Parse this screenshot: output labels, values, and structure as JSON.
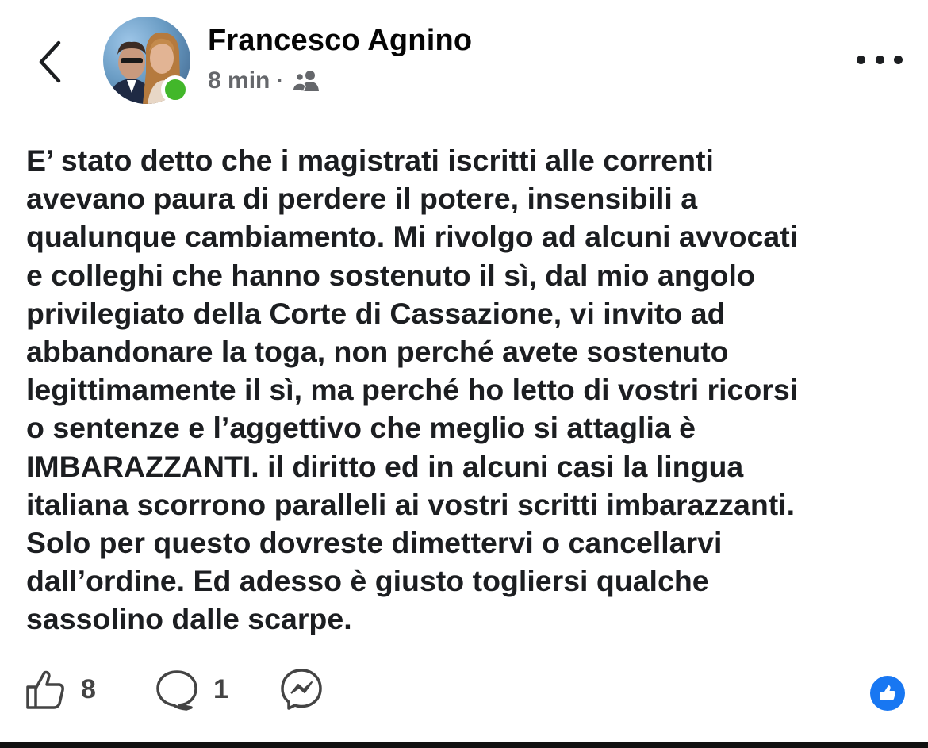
{
  "post": {
    "author_name": "Francesco Agnino",
    "time": "8 min",
    "separator": "·",
    "audience_icon": "friends-icon",
    "text_lines": [
      "E’ stato detto che i magistrati iscritti alle correnti",
      "avevano paura di perdere il potere, insensibili a",
      "qualunque cambiamento. Mi rivolgo ad alcuni avvocati",
      "e colleghi che hanno sostenuto il sì, dal mio angolo",
      "privilegiato della Corte di Cassazione, vi invito ad",
      "abbandonare la toga, non perché avete sostenuto",
      "legittimamente il sì, ma perché ho letto di vostri ricorsi",
      "o sentenze e l’aggettivo che meglio si attaglia è",
      "IMBARAZZANTI. il diritto ed in alcuni casi la lingua",
      "italiana scorrono paralleli ai vostri scritti imbarazzanti.",
      "Solo per questo dovreste dimettervi o cancellarvi",
      "dall’ordine. Ed adesso è giusto togliersi qualche",
      "sassolino dalle scarpe."
    ]
  },
  "actions": {
    "likes_count": "8",
    "comments_count": "1",
    "like_icon": "thumbs-up-icon",
    "comment_icon": "comment-bubble-icon",
    "share_icon": "messenger-icon",
    "reaction_icon": "like-reaction-icon"
  },
  "colors": {
    "online": "#42b72a",
    "reaction_blue": "#1877f2",
    "meta_gray": "#65676b"
  }
}
